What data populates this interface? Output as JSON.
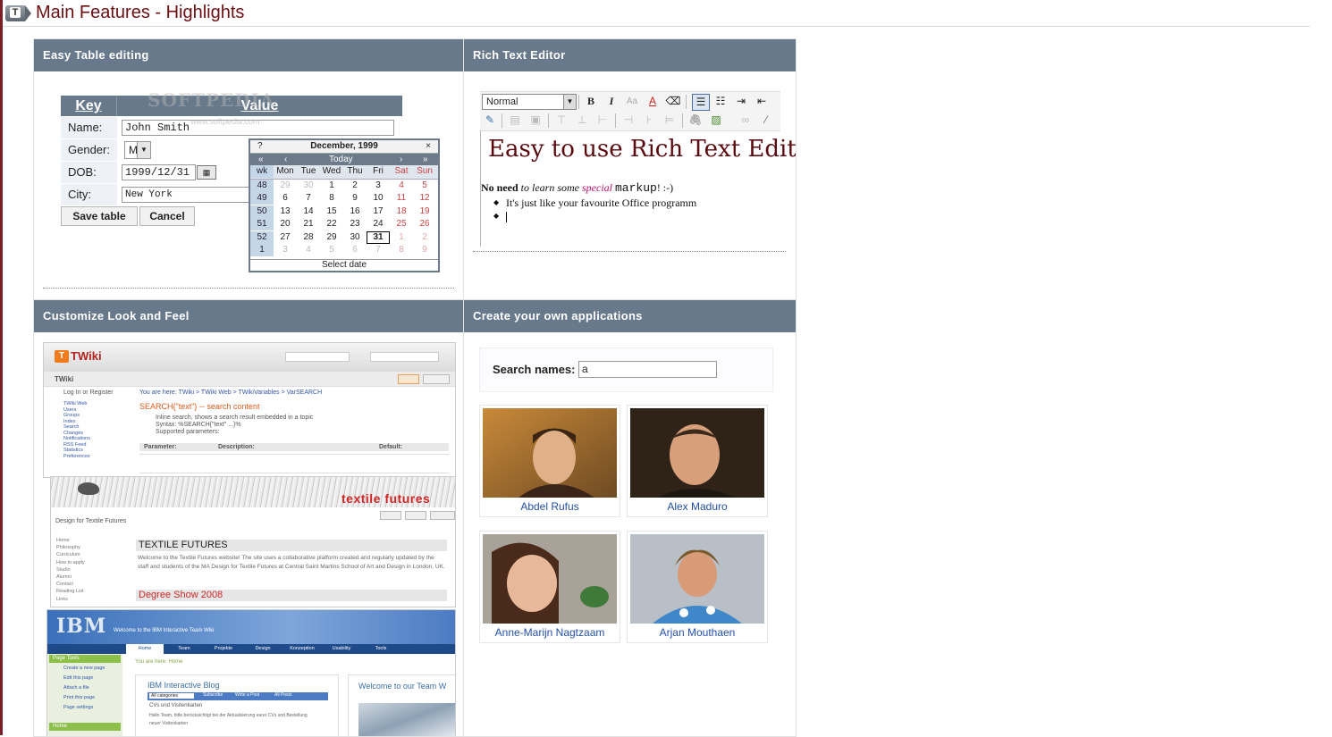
{
  "page": {
    "title": "Main Features - Highlights",
    "logo_letter": "T"
  },
  "panels": {
    "table_editing": {
      "heading": "Easy Table editing",
      "table": {
        "key_header": "Key",
        "value_header": "Value",
        "rows": [
          {
            "label": "Name:",
            "value": "John Smith"
          },
          {
            "label": "Gender:",
            "value": "M"
          },
          {
            "label": "DOB:",
            "value": "1999/12/31"
          },
          {
            "label": "City:",
            "value": "New York"
          }
        ],
        "save_label": "Save table",
        "cancel_label": "Cancel"
      },
      "watermark": "SOFTPEDIA",
      "watermark_url": "www.softpedia.com",
      "calendar": {
        "help": "?",
        "title": "December, 1999",
        "close": "×",
        "nav_prev_year": "«",
        "nav_prev": "‹",
        "today": "Today",
        "nav_next": "›",
        "nav_next_year": "»",
        "headers": [
          "wk",
          "Mon",
          "Tue",
          "Wed",
          "Thu",
          "Fri",
          "Sat",
          "Sun"
        ],
        "weeks": [
          [
            "48",
            "29",
            "30",
            "1",
            "2",
            "3",
            "4",
            "5"
          ],
          [
            "49",
            "6",
            "7",
            "8",
            "9",
            "10",
            "11",
            "12"
          ],
          [
            "50",
            "13",
            "14",
            "15",
            "16",
            "17",
            "18",
            "19"
          ],
          [
            "51",
            "20",
            "21",
            "22",
            "23",
            "24",
            "25",
            "26"
          ],
          [
            "52",
            "27",
            "28",
            "29",
            "30",
            "31",
            "1",
            "2"
          ],
          [
            "1",
            "3",
            "4",
            "5",
            "6",
            "7",
            "8",
            "9"
          ]
        ],
        "selected": "31",
        "footer": "Select date"
      }
    },
    "rich_text": {
      "heading": "Rich Text Editor",
      "format_select": "Normal",
      "tb_bold": "B",
      "tb_italic": "I",
      "tb_font": "Aa",
      "tb_color": "A",
      "editor_heading": "Easy to use Rich Text Editor",
      "para_bold": "No need",
      "para_italic": "to learn some",
      "para_pink": "special",
      "para_mono": "markup",
      "para_end": "! :-)",
      "list_item_1": "It's just like your favourite Office programm"
    },
    "look_feel": {
      "heading": "Customize Look and Feel",
      "shot1": {
        "brand": "TWiki",
        "web": "TWiki",
        "title": "SEARCH{\"text\"} -- search content",
        "side_items": [
          "Log In or Register",
          "TWiki Web",
          "Users",
          "Groups",
          "Index",
          "Search",
          "Changes",
          "Notifications",
          "RSS Feed",
          "Statistics",
          "Preferences"
        ],
        "bullets": [
          "Inline search, shows a search result embedded in a topic",
          "Syntax: %SEARCH{\"text\" ...}%",
          "Supported parameters:"
        ],
        "param_headers": [
          "Parameter:",
          "Description:",
          "Default:"
        ],
        "breadcrumb": "You are here: TWiki > TWiki Web > TWikiVariables > VarSEARCH"
      },
      "shot2": {
        "brand": "textile futures",
        "title": "TEXTILE FUTURES",
        "side_title": "Design for Textile Futures",
        "side_items": [
          "Home",
          "Philosophy",
          "Curriculum",
          "How to apply",
          "Studio",
          "Alumni",
          "Contact",
          "Reading List",
          "Links"
        ],
        "intro": "Welcome to the Textile Futures website! The site uses a collaborative platform created and regularly updated by the staff and students of the MA Design for Textile Futures at Central Saint Martins School of Art and Design in London, UK.",
        "section": "Degree Show 2008"
      },
      "shot3": {
        "brand": "IBM",
        "banner": "Welcome to the IBM Interactive Team Wiki",
        "tabs": [
          "Home",
          "Team",
          "Projekte",
          "Design",
          "Konzeption",
          "Usability",
          "Tools"
        ],
        "side_title": "Page Tools",
        "side_items": [
          "Create a new page",
          "Edit this page",
          "Attach a file",
          "Print this page",
          "Page settings"
        ],
        "side_home": "Home",
        "breadcrumb": "You are here: Home",
        "blog_title": "IBM Interactive Blog",
        "blog_filter": "All categories",
        "blog_links": [
          "Subscribe",
          "Write a Post",
          "All Posts"
        ],
        "blog_post": "CVs und Visitenkarten",
        "blog_text": "Hallo Team, bitte berücksichtigt bei der Aktualisierung eurer CVs und Bestellung neuer Visitenkarten",
        "welcome": "Welcome to our Team W"
      }
    },
    "apps": {
      "heading": "Create your own applications",
      "search_label": "Search names:",
      "search_value": "a",
      "people": [
        {
          "name": "Abdel Rufus"
        },
        {
          "name": "Alex Maduro"
        },
        {
          "name": "Anne-Marijn Nagtzaam"
        },
        {
          "name": "Arjan Mouthaen"
        }
      ]
    }
  },
  "colors": {
    "panel_header": "#67798b",
    "title": "#6b0f12",
    "link": "#2450a8"
  }
}
